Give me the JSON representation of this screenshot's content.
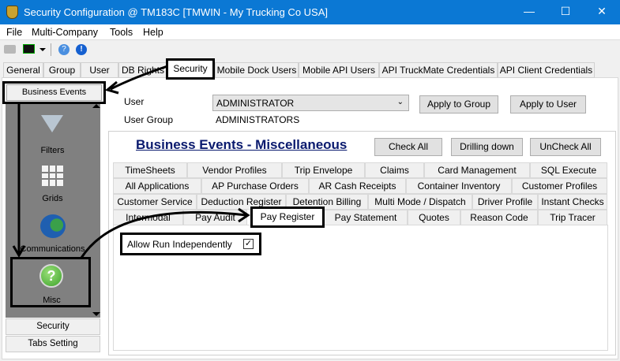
{
  "window": {
    "title": "Security Configuration @ TM183C [TMWIN - My Trucking Co USA]",
    "minimize": "—",
    "maximize": "☐",
    "close": "✕"
  },
  "menu": [
    "File",
    "Multi-Company",
    "Tools",
    "Help"
  ],
  "main_tabs": [
    "General",
    "Group",
    "User",
    "DB Rights",
    "Security",
    "Mobile Dock Users",
    "Mobile API Users",
    "API TruckMate Credentials",
    "API Client Credentials"
  ],
  "selected_main_tab": "Security",
  "nav": {
    "header": "Business Events",
    "items": [
      "Filters",
      "Grids",
      "Communications",
      "Misc"
    ],
    "selected": "Misc",
    "sections": [
      "Security",
      "Tabs Setting"
    ]
  },
  "form": {
    "user_label": "User",
    "user_value": "ADMINISTRATOR",
    "group_label": "User Group",
    "group_value": "ADMINISTRATORS",
    "apply_group": "Apply to Group",
    "apply_user": "Apply to User"
  },
  "panel": {
    "title": "Business Events - Miscellaneous",
    "check_all": "Check All",
    "drilling_down": "Drilling down",
    "uncheck_all": "UnCheck All"
  },
  "sub_tabs": [
    [
      "TimeSheets",
      "Vendor Profiles",
      "Trip Envelope",
      "Claims",
      "Card Management",
      "SQL Execute"
    ],
    [
      "All Applications",
      "AP Purchase Orders",
      "AR Cash Receipts",
      "Container Inventory",
      "Customer Profiles"
    ],
    [
      "Customer Service",
      "Deduction Register",
      "Detention Billing",
      "Multi Mode / Dispatch",
      "Driver Profile",
      "Instant Checks"
    ],
    [
      "Intermodal",
      "Pay Audit",
      "Pay Register",
      "Pay Statement",
      "Quotes",
      "Reason Code",
      "Trip Tracer"
    ]
  ],
  "selected_sub_tab": "Pay Register",
  "option": {
    "label": "Allow Run Independently",
    "checked": true,
    "check_glyph": "✓"
  },
  "colors": {
    "titlebar": "#0b78d4",
    "panel_title": "#0a1a6e",
    "nav_bg": "#808080"
  }
}
